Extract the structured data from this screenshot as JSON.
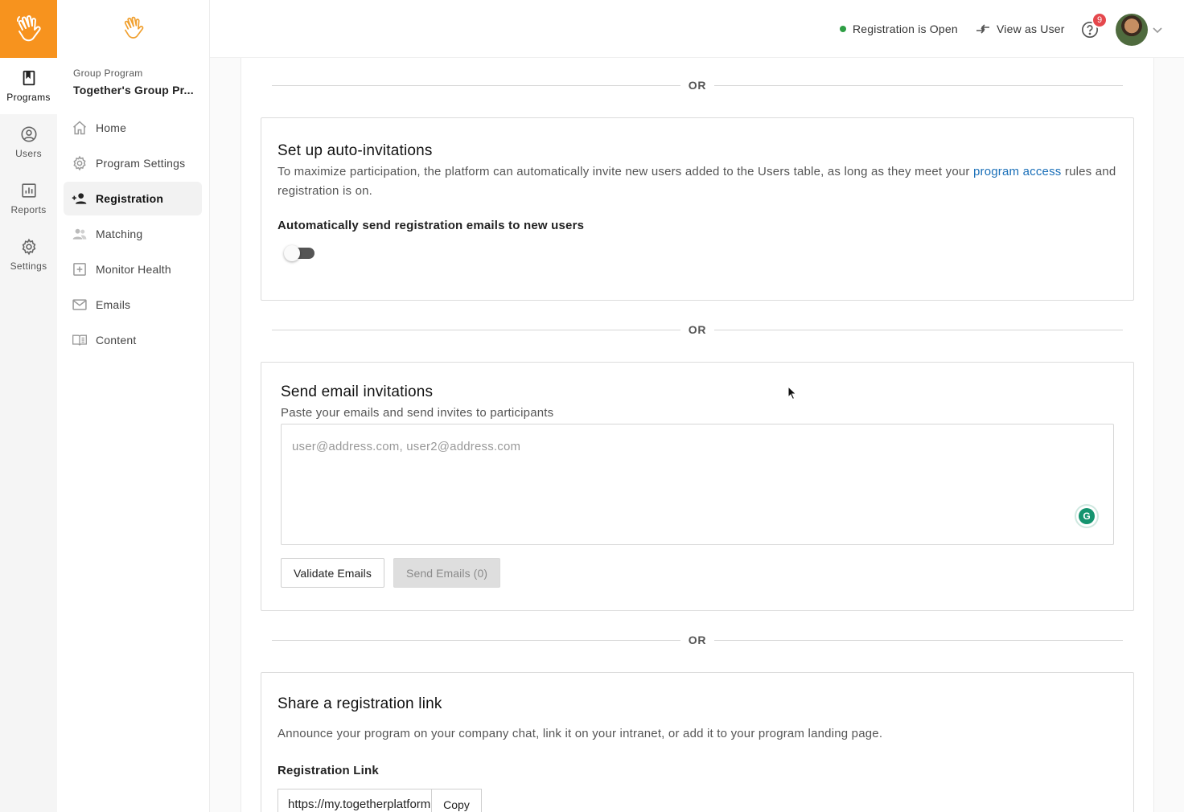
{
  "rail": {
    "items": [
      {
        "label": "Programs",
        "icon": "book-icon",
        "active": true
      },
      {
        "label": "Users",
        "icon": "user-circle-icon",
        "active": false
      },
      {
        "label": "Reports",
        "icon": "chart-icon",
        "active": false
      },
      {
        "label": "Settings",
        "icon": "gear-icon",
        "active": false
      }
    ]
  },
  "sidebar": {
    "program_type": "Group Program",
    "program_name": "Together's Group Pr...",
    "items": [
      {
        "label": "Home",
        "icon": "home-icon"
      },
      {
        "label": "Program Settings",
        "icon": "gear-icon"
      },
      {
        "label": "Registration",
        "icon": "add-user-icon",
        "active": true
      },
      {
        "label": "Matching",
        "icon": "users-icon"
      },
      {
        "label": "Monitor Health",
        "icon": "plus-box-icon"
      },
      {
        "label": "Emails",
        "icon": "mail-icon"
      },
      {
        "label": "Content",
        "icon": "book-open-icon"
      }
    ]
  },
  "topbar": {
    "registration_status": "Registration is Open",
    "view_as_user": "View as User",
    "notification_count": "9"
  },
  "main": {
    "or_label": "OR",
    "auto_invite": {
      "title": "Set up auto-invitations",
      "description_before": "To maximize participation, the platform can automatically invite new users added to the Users table, as long as they meet your ",
      "description_link": "program access",
      "description_after": " rules and registration is on.",
      "toggle_label": "Automatically send registration emails to new users",
      "toggle_on": false
    },
    "email_invite": {
      "title": "Send email invitations",
      "subtitle": "Paste your emails and send invites to participants",
      "placeholder": "user@address.com, user2@address.com",
      "validate_label": "Validate Emails",
      "send_label": "Send Emails (0)"
    },
    "share_link": {
      "title": "Share a registration link",
      "description": "Announce your program on your company chat, link it on your intranet, or add it to your program landing page.",
      "link_label": "Registration Link",
      "link_value": "https://my.togetherplatform.com",
      "copy_label": "Copy"
    }
  },
  "colors": {
    "brand_orange": "#f7931e",
    "status_green": "#2e9e44",
    "link_blue": "#1a6fb8",
    "badge_red": "#e5484d"
  }
}
